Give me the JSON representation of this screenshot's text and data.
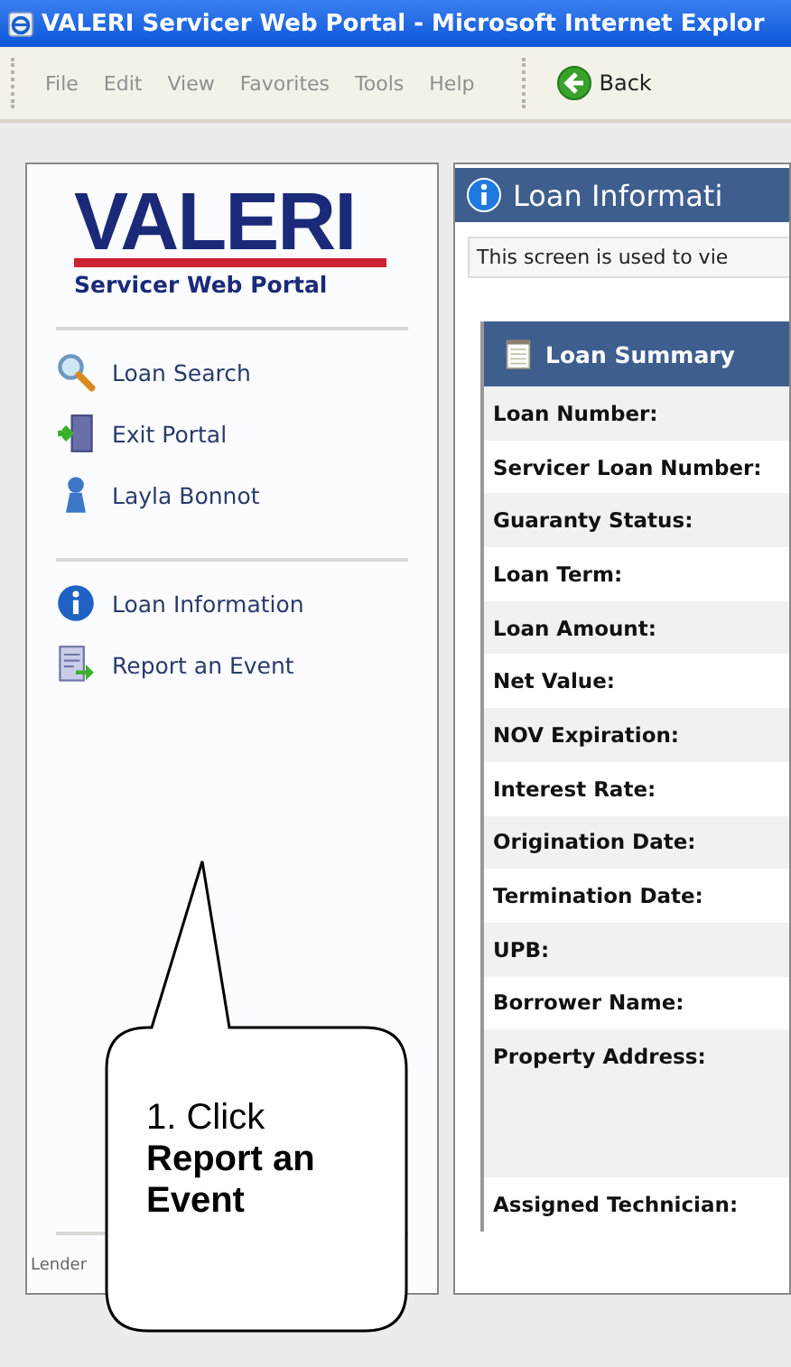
{
  "window": {
    "title": "VALERI Servicer Web Portal - Microsoft Internet Explor"
  },
  "menu": [
    "File",
    "Edit",
    "View",
    "Favorites",
    "Tools",
    "Help"
  ],
  "toolbar": {
    "back": "Back"
  },
  "sidebar": {
    "logo": "VALERI",
    "subtitle": "Servicer Web Portal",
    "groups": [
      [
        {
          "label": "Loan Search"
        },
        {
          "label": "Exit Portal"
        },
        {
          "label": "Layla Bonnot"
        }
      ],
      [
        {
          "label": "Loan Information"
        },
        {
          "label": "Report an Event"
        }
      ]
    ],
    "footer": "Lender"
  },
  "main": {
    "title": "Loan Informati",
    "description": "This screen is used to vie",
    "summary": {
      "title": "Loan Summary",
      "fields": [
        {
          "label": "Loan Number:"
        },
        {
          "label": "Servicer Loan Number:"
        },
        {
          "label": "Guaranty Status:"
        },
        {
          "label": "Loan Term:"
        },
        {
          "label": "Loan Amount:"
        },
        {
          "label": "Net Value:"
        },
        {
          "label": "NOV Expiration:"
        },
        {
          "label": "Interest Rate:"
        },
        {
          "label": "Origination Date:"
        },
        {
          "label": "Termination Date:"
        },
        {
          "label": "UPB:"
        },
        {
          "label": "Borrower Name:"
        },
        {
          "label": "Property Address:",
          "tall": true
        },
        {
          "label": "Assigned Technician:"
        }
      ]
    }
  },
  "callout": {
    "text": "1. Click **Report an Event**"
  }
}
